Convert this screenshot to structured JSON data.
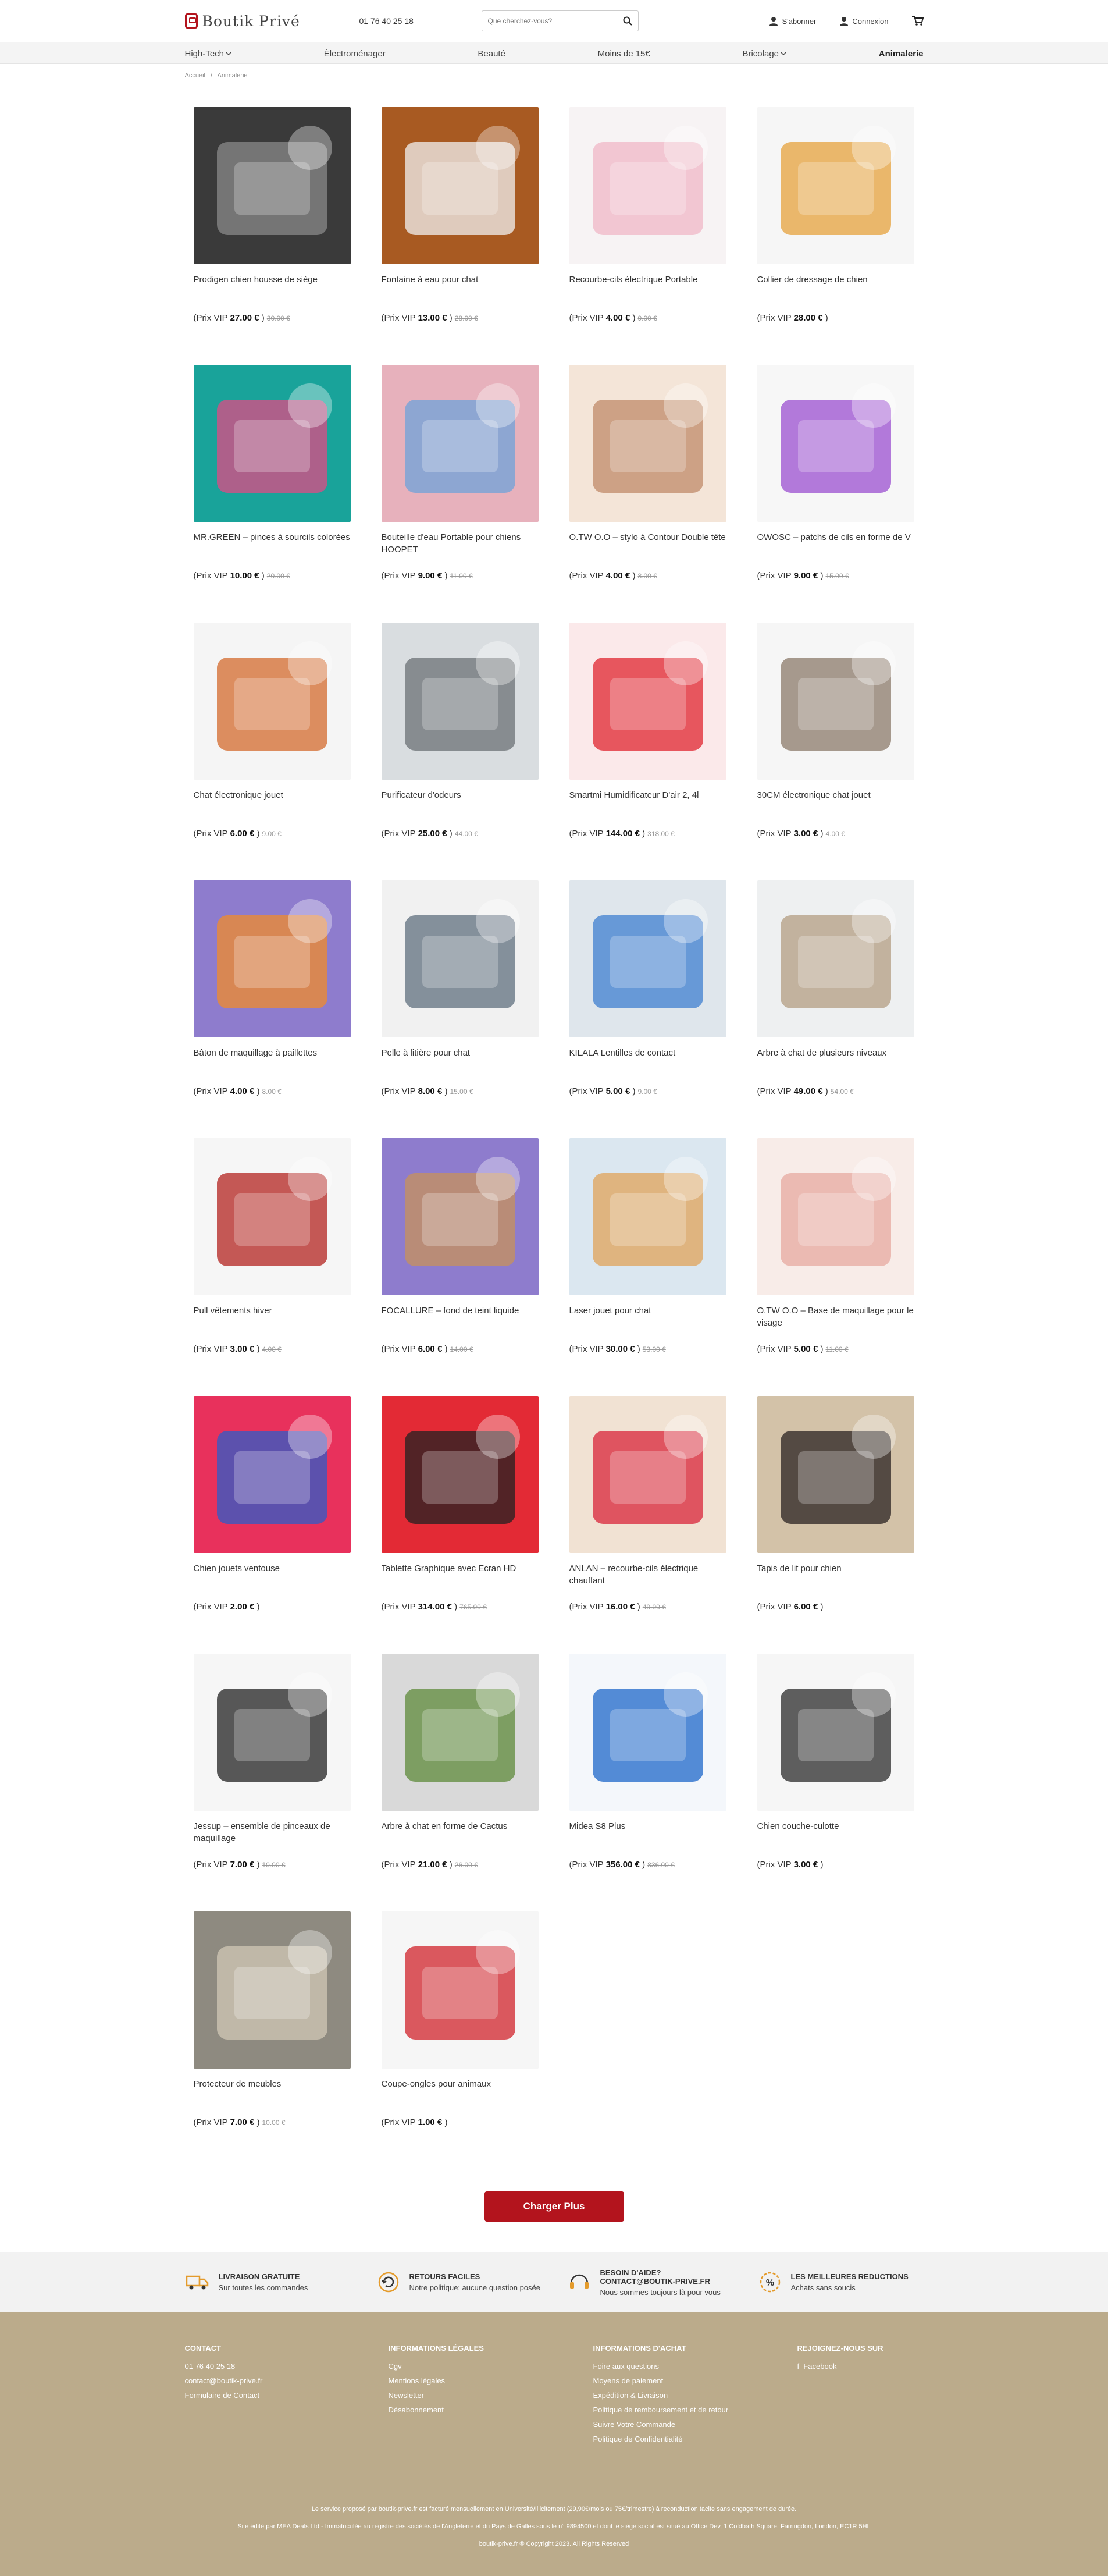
{
  "header": {
    "logo_text": "Boutik Privé",
    "phone": "01 76 40 25 18",
    "search_placeholder": "Que cherchez-vous?",
    "subscribe": "S'abonner",
    "login": "Connexion"
  },
  "nav": [
    {
      "label": "High-Tech",
      "chevron": true
    },
    {
      "label": "Électroménager",
      "chevron": false
    },
    {
      "label": "Beauté",
      "chevron": false
    },
    {
      "label": "Moins de 15€",
      "chevron": false
    },
    {
      "label": "Bricolage",
      "chevron": true
    },
    {
      "label": "Animalerie",
      "chevron": false
    }
  ],
  "breadcrumb": [
    "Accueil",
    "/",
    "Animalerie"
  ],
  "price_prefix": "(Prix VIP",
  "price_suffix": ")",
  "products": [
    {
      "title": "Prodigen chien housse de siège",
      "price": "27.00 €",
      "old": "30.00 €",
      "bg": "#3a3a3a",
      "accent": "#8a8a8a"
    },
    {
      "title": "Fontaine à eau pour chat",
      "price": "13.00 €",
      "old": "28.00 €",
      "bg": "#a85a22",
      "accent": "#f2f2f2"
    },
    {
      "title": "Recourbe-cils électrique Portable",
      "price": "4.00 €",
      "old": "9.00 €",
      "bg": "#f7f3f4",
      "accent": "#f0b7c7"
    },
    {
      "title": "Collier de dressage de chien",
      "price": "28.00 €",
      "old": "",
      "bg": "#f6f6f6",
      "accent": "#e6a23c"
    },
    {
      "title": "MR.GREEN – pinces à sourcils colorées",
      "price": "10.00 €",
      "old": "20.00 €",
      "bg": "#19a39a",
      "accent": "#e04a84"
    },
    {
      "title": "Bouteille d'eau Portable pour chiens HOOPET",
      "price": "9.00 €",
      "old": "11.00 €",
      "bg": "#e7b1bc",
      "accent": "#6fa3d9"
    },
    {
      "title": "O.TW O.O – stylo à Contour Double tête",
      "price": "4.00 €",
      "old": "8.00 €",
      "bg": "#f4e5d8",
      "accent": "#c08a6a"
    },
    {
      "title": "OWOSC – patchs de cils en forme de V",
      "price": "9.00 €",
      "old": "15.00 €",
      "bg": "#f7f7f7",
      "accent": "#9b4fd0"
    },
    {
      "title": "Chat électronique jouet",
      "price": "6.00 €",
      "old": "9.00 €",
      "bg": "#f5f5f5",
      "accent": "#d36a2c"
    },
    {
      "title": "Purificateur d'odeurs",
      "price": "25.00 €",
      "old": "44.00 €",
      "bg": "#d9dde0",
      "accent": "#6b7075"
    },
    {
      "title": "Smartmi Humidificateur D'air 2, 4l",
      "price": "144.00 €",
      "old": "318.00 €",
      "bg": "#fbe9ea",
      "accent": "#e0242f"
    },
    {
      "title": "30CM électronique chat jouet",
      "price": "3.00 €",
      "old": "4.00 €",
      "bg": "#f6f6f6",
      "accent": "#8b7a6a"
    },
    {
      "title": "Bâton de maquillage à paillettes",
      "price": "4.00 €",
      "old": "8.00 €",
      "bg": "#8e7ccd",
      "accent": "#f08b2a"
    },
    {
      "title": "Pelle à litière pour chat",
      "price": "8.00 €",
      "old": "15.00 €",
      "bg": "#f1f1f1",
      "accent": "#5f6f7d"
    },
    {
      "title": "KILALA Lentilles de contact",
      "price": "5.00 €",
      "old": "9.00 €",
      "bg": "#dfe6ec",
      "accent": "#3f7fd0"
    },
    {
      "title": "Arbre à chat de plusieurs niveaux",
      "price": "49.00 €",
      "old": "54.00 €",
      "bg": "#eef0f1",
      "accent": "#b39e82"
    },
    {
      "title": "Pull vêtements hiver",
      "price": "3.00 €",
      "old": "4.00 €",
      "bg": "#f6f6f6",
      "accent": "#b3231f"
    },
    {
      "title": "FOCALLURE – fond de teint liquide",
      "price": "6.00 €",
      "old": "14.00 €",
      "bg": "#8e7ccd",
      "accent": "#c7925a"
    },
    {
      "title": "Laser jouet pour chat",
      "price": "30.00 €",
      "old": "53.00 €",
      "bg": "#dbe7f0",
      "accent": "#e0a35a"
    },
    {
      "title": "O.TW O.O – Base de maquillage pour le visage",
      "price": "5.00 €",
      "old": "11.00 €",
      "bg": "#f8ece8",
      "accent": "#e7a9a0"
    },
    {
      "title": "Chien jouets ventouse",
      "price": "2.00 €",
      "old": "",
      "bg": "#e8315c",
      "accent": "#2d5cc8"
    },
    {
      "title": "Tablette Graphique avec Ecran HD",
      "price": "314.00 €",
      "old": "765.00 €",
      "bg": "#e32a35",
      "accent": "#222222"
    },
    {
      "title": "ANLAN – recourbe-cils électrique chauffant",
      "price": "16.00 €",
      "old": "49.00 €",
      "bg": "#f1e2d3",
      "accent": "#d8243a"
    },
    {
      "title": "Tapis de lit pour chien",
      "price": "6.00 €",
      "old": "",
      "bg": "#d3c2a8",
      "accent": "#2a2222"
    },
    {
      "title": "Jessup – ensemble de pinceaux de maquillage",
      "price": "7.00 €",
      "old": "10.00 €",
      "bg": "#f6f6f6",
      "accent": "#222222"
    },
    {
      "title": "Arbre à chat en forme de Cactus",
      "price": "21.00 €",
      "old": "26.00 €",
      "bg": "#d9d9d9",
      "accent": "#5e8a3a"
    },
    {
      "title": "Midea S8 Plus",
      "price": "356.00 €",
      "old": "836.00 €",
      "bg": "#f4f7fb",
      "accent": "#1e67c9"
    },
    {
      "title": "Chien couche-culotte",
      "price": "3.00 €",
      "old": "",
      "bg": "#f6f6f6",
      "accent": "#2b2b2b"
    },
    {
      "title": "Protecteur de meubles",
      "price": "7.00 €",
      "old": "10.00 €",
      "bg": "#8e8a80",
      "accent": "#d0c7b6"
    },
    {
      "title": "Coupe-ongles pour animaux",
      "price": "1.00 €",
      "old": "",
      "bg": "#f6f6f6",
      "accent": "#d0232b"
    }
  ],
  "load_more": "Charger Plus",
  "features": [
    {
      "title": "LIVRAISON GRATUITE",
      "subtitle": "Sur toutes les commandes",
      "icon": "truck-icon"
    },
    {
      "title": "RETOURS FACILES",
      "subtitle": "Notre politique; aucune question posée",
      "icon": "return-icon"
    },
    {
      "title": "BESOIN D'AIDE? contact@boutik-prive.fr",
      "subtitle": "Nous sommes toujours là pour vous",
      "icon": "support-icon"
    },
    {
      "title": "LES MEILLEURES REDUCTIONS",
      "subtitle": "Achats sans soucis",
      "icon": "discount-icon"
    }
  ],
  "footer": {
    "contact": {
      "title": "CONTACT",
      "items": [
        "01 76 40 25 18",
        "contact@boutik-prive.fr",
        "Formulaire de Contact"
      ]
    },
    "legal": {
      "title": "INFORMATIONS LÉGALES",
      "items": [
        "Cgv",
        "Mentions légales",
        "Newsletter",
        "Désabonnement"
      ]
    },
    "purchase": {
      "title": "INFORMATIONS D'ACHAT",
      "items": [
        "Foire aux questions",
        "Moyens de paiement",
        "Expédition & Livraison",
        "Politique de remboursement et de retour",
        "Suivre Votre Commande",
        "Politique de Confidentialité"
      ]
    },
    "social": {
      "title": "REJOIGNEZ-NOUS SUR",
      "items": [
        "Facebook"
      ]
    },
    "legal_text_1": "Le service proposé par boutik-prive.fr est facturé mensuellement en Université/Illicitement (29,90€/mois ou 75€/trimestre) à reconduction tacite sans engagement de durée.",
    "legal_text_2": "Site édité par MEA Deals Ltd - Immatriculée au registre des sociétés de l'Angleterre et du Pays de Galles sous le n° 9894500 et dont le siège social est situé au Office Dev, 1 Coldbath Square, Farringdon, London, EC1R 5HL",
    "copyright": "boutik-prive.fr ® Copyright 2023. All Rights Reserved"
  }
}
